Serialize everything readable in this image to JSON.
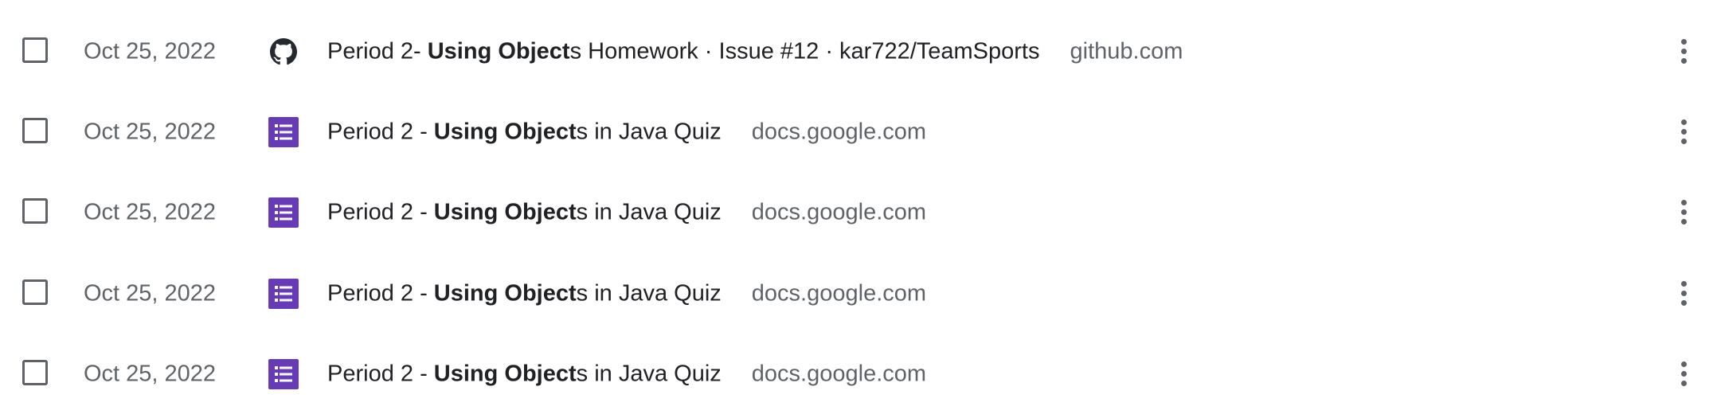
{
  "history": {
    "items": [
      {
        "date": "Oct 25, 2022",
        "favicon": "github-icon",
        "title_before": "Period 2- ",
        "title_bold": "Using Object",
        "title_after": "s Homework · Issue #12 · kar722/TeamSports",
        "domain": "github.com"
      },
      {
        "date": "Oct 25, 2022",
        "favicon": "google-forms-icon",
        "title_before": "Period 2 - ",
        "title_bold": "Using Object",
        "title_after": "s in Java Quiz",
        "domain": "docs.google.com"
      },
      {
        "date": "Oct 25, 2022",
        "favicon": "google-forms-icon",
        "title_before": "Period 2 - ",
        "title_bold": "Using Object",
        "title_after": "s in Java Quiz",
        "domain": "docs.google.com"
      },
      {
        "date": "Oct 25, 2022",
        "favicon": "google-forms-icon",
        "title_before": "Period 2 - ",
        "title_bold": "Using Object",
        "title_after": "s in Java Quiz",
        "domain": "docs.google.com"
      },
      {
        "date": "Oct 25, 2022",
        "favicon": "google-forms-icon",
        "title_before": "Period 2 - ",
        "title_bold": "Using Object",
        "title_after": "s in Java Quiz",
        "domain": "docs.google.com"
      }
    ]
  },
  "colors": {
    "forms_purple": "#673ab7",
    "text_primary": "#202124",
    "text_secondary": "#5f6368"
  }
}
